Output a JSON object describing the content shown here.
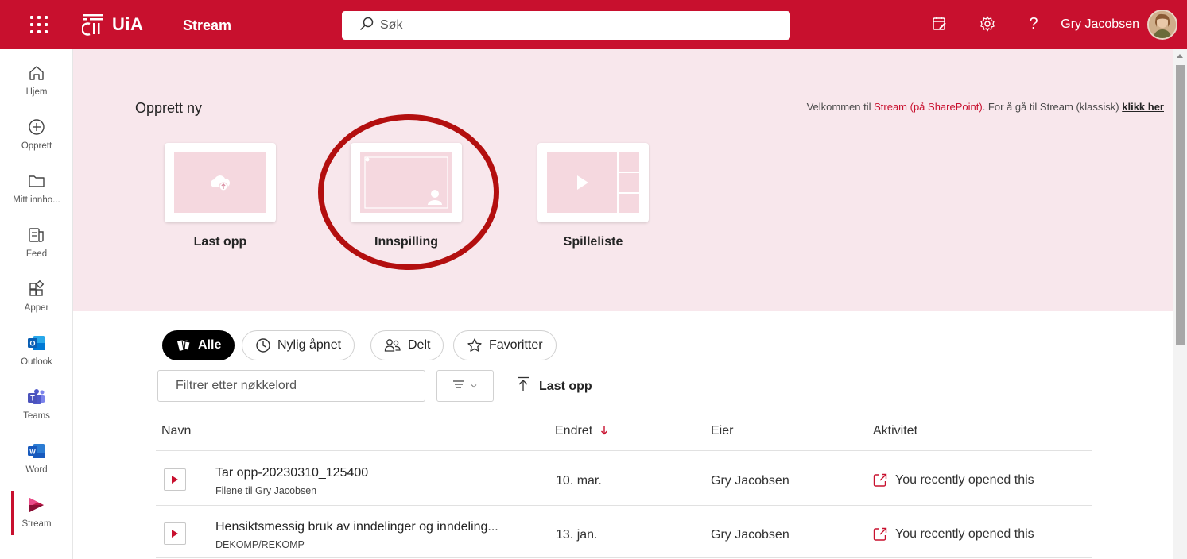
{
  "colors": {
    "brand": "#c8102e",
    "hero_bg": "#f8e7ec",
    "thumb": "#f5d8df",
    "ring": "#b30f0f"
  },
  "topbar": {
    "brand": "UiA",
    "app_name": "Stream",
    "search_placeholder": "Søk",
    "help_glyph": "?",
    "user_name": "Gry Jacobsen"
  },
  "rail": {
    "items": [
      {
        "label": "Hjem",
        "icon": "home-icon"
      },
      {
        "label": "Opprett",
        "icon": "add-circle-icon"
      },
      {
        "label": "Mitt innho...",
        "icon": "folder-icon"
      },
      {
        "label": "Feed",
        "icon": "feed-icon"
      },
      {
        "label": "Apper",
        "icon": "apps-icon"
      },
      {
        "label": "Outlook",
        "icon": "outlook-icon"
      },
      {
        "label": "Teams",
        "icon": "teams-icon"
      },
      {
        "label": "Word",
        "icon": "word-icon"
      },
      {
        "label": "Stream",
        "icon": "stream-icon"
      }
    ]
  },
  "hero": {
    "title": "Opprett ny",
    "welcome_prefix": "Velkommen til ",
    "welcome_highlight": "Stream (på SharePoint)",
    "welcome_middle": ". For å gå til Stream (klassisk) ",
    "welcome_link": "klikk her",
    "cards": [
      {
        "label": "Last opp",
        "icon": "cloud-upload-icon"
      },
      {
        "label": "Innspilling",
        "icon": "record-screen-icon"
      },
      {
        "label": "Spilleliste",
        "icon": "playlist-icon"
      }
    ]
  },
  "filters": {
    "pills": [
      {
        "label": "Alle",
        "active": true
      },
      {
        "label": "Nylig åpnet",
        "active": false
      },
      {
        "label": "Delt",
        "active": false
      },
      {
        "label": "Favoritter",
        "active": false
      }
    ],
    "keyword_placeholder": "Filtrer etter nøkkelord",
    "upload_label": "Last opp"
  },
  "table": {
    "headers": {
      "name": "Navn",
      "modified": "Endret",
      "owner": "Eier",
      "activity": "Aktivitet"
    },
    "rows": [
      {
        "title": "Tar opp-20230310_125400",
        "subtitle": "Filene til Gry Jacobsen",
        "date": "10. mar.",
        "owner": "Gry Jacobsen",
        "activity": "You recently opened this"
      },
      {
        "title": "Hensiktsmessig bruk av inndelinger og inndeling...",
        "subtitle": "DEKOMP/REKOMP",
        "date": "13. jan.",
        "owner": "Gry Jacobsen",
        "activity": "You recently opened this"
      }
    ]
  }
}
